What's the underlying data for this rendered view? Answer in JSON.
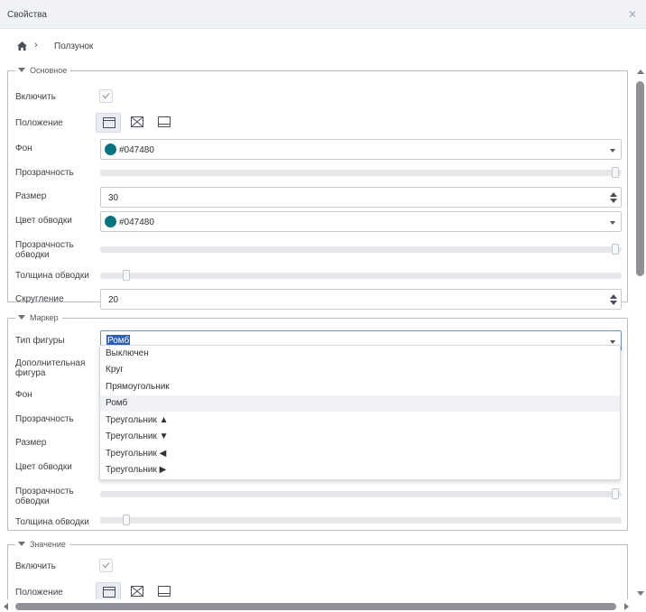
{
  "window": {
    "title": "Свойства"
  },
  "breadcrumb": {
    "current": "Ползунок"
  },
  "colors": {
    "swatch": "#047480",
    "accent": "#2f5fb3"
  },
  "icons": {
    "home": "home-icon",
    "chevron": "chevron-right-icon",
    "close": "close-icon",
    "check": "check-icon"
  },
  "basic": {
    "legend": "Основное",
    "enable": {
      "label": "Включить",
      "checked": true
    },
    "position": {
      "label": "Положение"
    },
    "bg": {
      "label": "Фон",
      "value": "#047480"
    },
    "opacity": {
      "label": "Прозрачность",
      "value": 1.0
    },
    "size": {
      "label": "Размер",
      "value": "30"
    },
    "stroke_color": {
      "label": "Цвет обводки",
      "value": "#047480"
    },
    "stroke_opacity": {
      "label": "Прозрачность обводки",
      "value": 1.0
    },
    "stroke_width": {
      "label": "Толщина обводки",
      "value": 0.05
    },
    "rounding": {
      "label": "Скругление",
      "value": "20"
    }
  },
  "marker": {
    "legend": "Маркер",
    "shape_type": {
      "label": "Тип фигуры",
      "value": "Ромб"
    },
    "extra_shape": {
      "label": "Дополнительная фигура"
    },
    "bg": {
      "label": "Фон"
    },
    "opacity": {
      "label": "Прозрачность"
    },
    "size": {
      "label": "Размер"
    },
    "stroke_color": {
      "label": "Цвет обводки"
    },
    "stroke_opacity": {
      "label": "Прозрачность обводки",
      "value": 1.0
    },
    "stroke_width": {
      "label": "Толщина обводки",
      "value": 0.05
    }
  },
  "dropdown": {
    "options": [
      "Выключен",
      "Круг",
      "Прямоугольник",
      "Ромб",
      "Треугольник ▲",
      "Треугольник ▼",
      "Треугольник ◀",
      "Треугольник ▶"
    ],
    "highlighted": "Ромб"
  },
  "value_group": {
    "legend": "Значение",
    "enable": {
      "label": "Включить",
      "checked": true
    },
    "position": {
      "label": "Положение"
    }
  }
}
